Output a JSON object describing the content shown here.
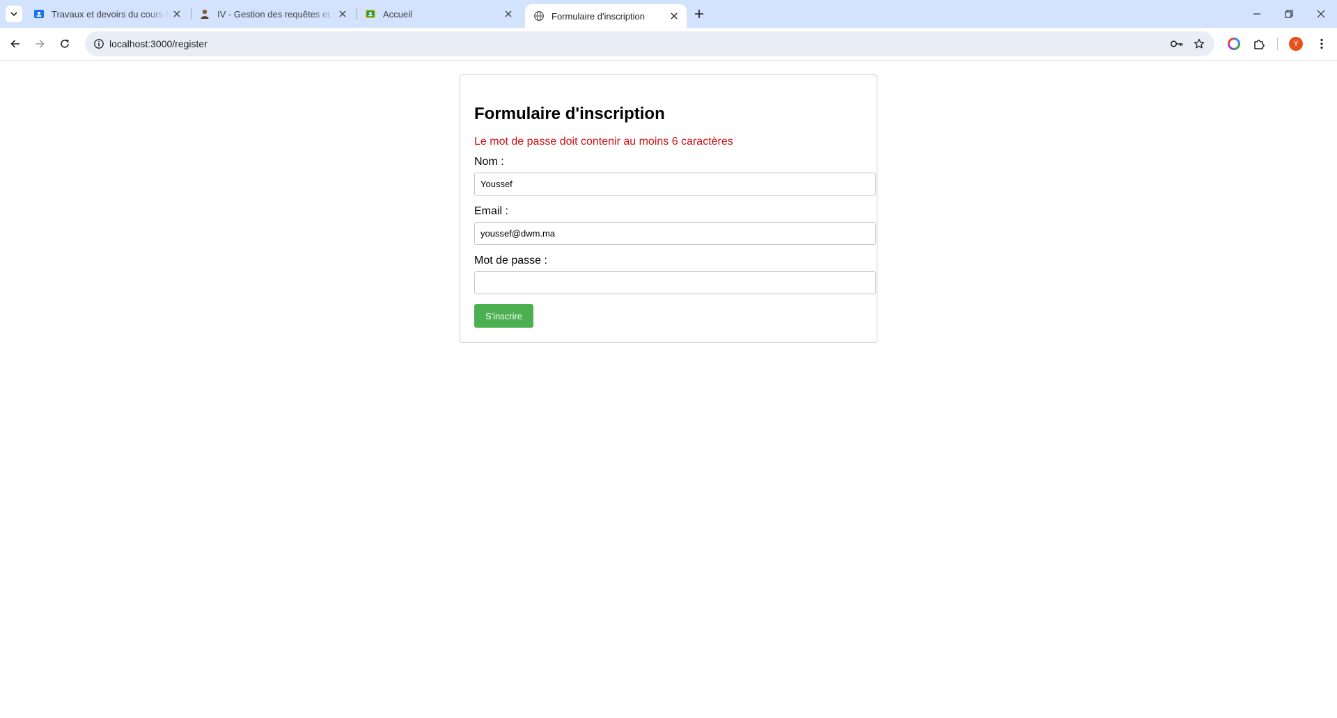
{
  "browser": {
    "tabs": [
      {
        "title": "Travaux et devoirs du cours No",
        "icon": "classroom-icon",
        "active": false
      },
      {
        "title": "IV - Gestion des requêtes et rép",
        "icon": "person-icon",
        "active": false
      },
      {
        "title": "Accueil",
        "icon": "classroom-icon",
        "active": false
      },
      {
        "title": "Formulaire d'inscription",
        "icon": "globe-icon",
        "active": true
      }
    ],
    "url": "localhost:3000/register",
    "profile_initial": "Y",
    "colors": {
      "tabstrip": "#d3e3fd",
      "omnibox": "#e9eef6",
      "avatar": "#e8501d"
    }
  },
  "page": {
    "form": {
      "title": "Formulaire d'inscription",
      "error": "Le mot de passe doit contenir au moins 6 caractères",
      "fields": {
        "name": {
          "label": "Nom :",
          "value": "Youssef"
        },
        "email": {
          "label": "Email :",
          "value": "youssef@dwm.ma"
        },
        "password": {
          "label": "Mot de passe :",
          "value": ""
        }
      },
      "submit_label": "S'inscrire"
    },
    "colors": {
      "error": "#cc1111",
      "submit": "#4caf50"
    }
  }
}
